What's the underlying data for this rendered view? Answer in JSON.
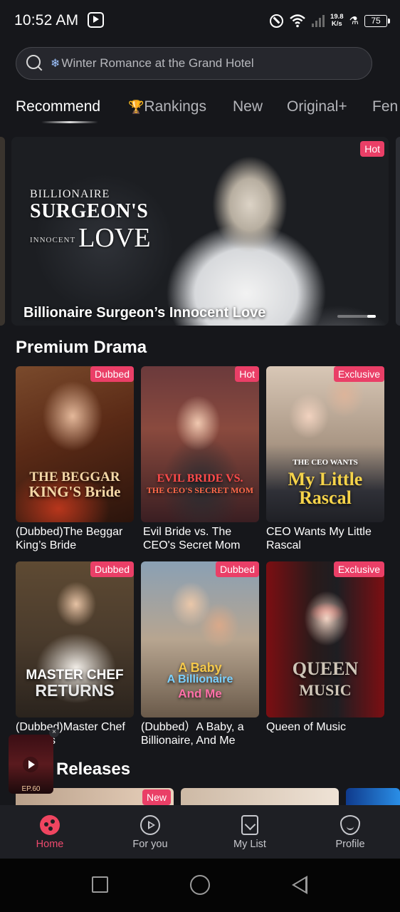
{
  "status_bar": {
    "time": "10:52 AM",
    "net_speed_value": "19.8",
    "net_speed_unit": "K/s",
    "battery": "75"
  },
  "search": {
    "placeholder": "Winter Romance at the Grand Hotel",
    "icon": "search-icon",
    "prefix_icon": "snowflake-icon"
  },
  "tabs": [
    {
      "label": "Recommend",
      "active": true
    },
    {
      "label": "Rankings",
      "icon": "trophy-icon"
    },
    {
      "label": "New"
    },
    {
      "label": "Original+"
    },
    {
      "label": "Fen"
    }
  ],
  "banner": {
    "logo_line1": "BILLIONAIRE",
    "logo_line2": "SURGEON'S",
    "logo_line3": "INNOCENT",
    "logo_line4": "LOVE",
    "title": "Billionaire Surgeon’s Innocent Love",
    "badge": "Hot",
    "page_index": 4,
    "page_count": 4
  },
  "premium": {
    "title": "Premium Drama",
    "cards": [
      {
        "title": "(Dubbed)The Beggar King’s Bride",
        "badge": "Dubbed",
        "poster_text": [
          "THE BEGGAR",
          "KING'S Bride"
        ]
      },
      {
        "title": "Evil Bride vs. The CEO's Secret Mom",
        "badge": "Hot",
        "poster_text": [
          "EVIL BRIDE VS.",
          "THE CEO'S SECRET MOM"
        ]
      },
      {
        "title": "CEO Wants My Little Rascal",
        "badge": "Exclusive",
        "poster_text": [
          "THE CEO WANTS",
          "My Little Rascal"
        ]
      },
      {
        "title": "(Dubbed)Master Chef Returns",
        "badge": "Dubbed",
        "poster_text": [
          "MASTER CHEF",
          "RETURNS"
        ]
      },
      {
        "title": "(Dubbed）A Baby, a Billionaire, And Me",
        "badge": "Dubbed",
        "poster_text": [
          "A Baby",
          "A Billionaire",
          "And Me"
        ]
      },
      {
        "title": "Queen of Music",
        "badge": "Exclusive",
        "poster_text": [
          "QUEEN",
          "MUSIC"
        ]
      }
    ]
  },
  "new_releases": {
    "title": "New Releases",
    "visible_title": "Releases",
    "first_badge": "New"
  },
  "mini_player": {
    "episode": "EP.60",
    "close": "×"
  },
  "bottom_nav": [
    {
      "label": "Home",
      "icon": "home-icon",
      "active": true
    },
    {
      "label": "For you",
      "icon": "play-circle-icon"
    },
    {
      "label": "My List",
      "icon": "bookmark-icon"
    },
    {
      "label": "Profile",
      "icon": "profile-icon"
    }
  ],
  "colors": {
    "accent": "#ea3f67",
    "background": "#16171b",
    "nav_background": "#1e1f24"
  }
}
